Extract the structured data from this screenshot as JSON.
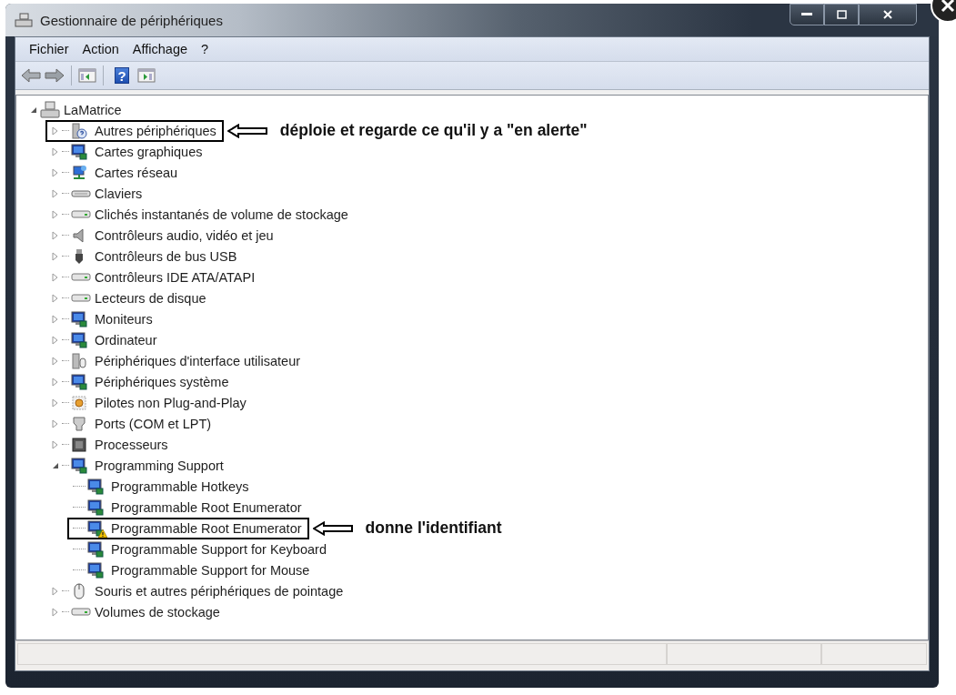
{
  "window": {
    "title": "Gestionnaire de périphériques"
  },
  "menu": [
    {
      "label": "Fichier"
    },
    {
      "label": "Action"
    },
    {
      "label": "Affichage"
    },
    {
      "label": "?"
    }
  ],
  "toolbar": {
    "back_disabled": true,
    "help_glyph": "?"
  },
  "tree": {
    "label": "LaMatrice",
    "expanded": true,
    "children": [
      {
        "label": "Autres périphériques",
        "expanded": false,
        "callout": "déploie et regarde ce qu'il y a \"en alerte\""
      },
      {
        "label": "Cartes graphiques",
        "expanded": false
      },
      {
        "label": "Cartes réseau",
        "expanded": false
      },
      {
        "label": "Claviers",
        "expanded": false
      },
      {
        "label": "Clichés instantanés de volume de stockage",
        "expanded": false
      },
      {
        "label": "Contrôleurs audio, vidéo et jeu",
        "expanded": false
      },
      {
        "label": "Contrôleurs de bus USB",
        "expanded": false
      },
      {
        "label": "Contrôleurs IDE ATA/ATAPI",
        "expanded": false
      },
      {
        "label": "Lecteurs de disque",
        "expanded": false
      },
      {
        "label": "Moniteurs",
        "expanded": false
      },
      {
        "label": "Ordinateur",
        "expanded": false
      },
      {
        "label": "Périphériques d'interface utilisateur",
        "expanded": false
      },
      {
        "label": "Périphériques système",
        "expanded": false
      },
      {
        "label": "Pilotes non Plug-and-Play",
        "expanded": false
      },
      {
        "label": "Ports (COM et LPT)",
        "expanded": false
      },
      {
        "label": "Processeurs",
        "expanded": false
      },
      {
        "label": "Programming Support",
        "expanded": true,
        "children": [
          {
            "label": "Programmable Hotkeys",
            "warning": false
          },
          {
            "label": "Programmable Root Enumerator",
            "warning": false
          },
          {
            "label": "Programmable Root Enumerator",
            "warning": true,
            "callout": "donne l'identifiant"
          },
          {
            "label": "Programmable Support for Keyboard",
            "warning": false
          },
          {
            "label": "Programmable Support for Mouse",
            "warning": false
          }
        ]
      },
      {
        "label": "Souris et autres périphériques de pointage",
        "expanded": false
      },
      {
        "label": "Volumes de stockage",
        "expanded": false
      }
    ]
  }
}
